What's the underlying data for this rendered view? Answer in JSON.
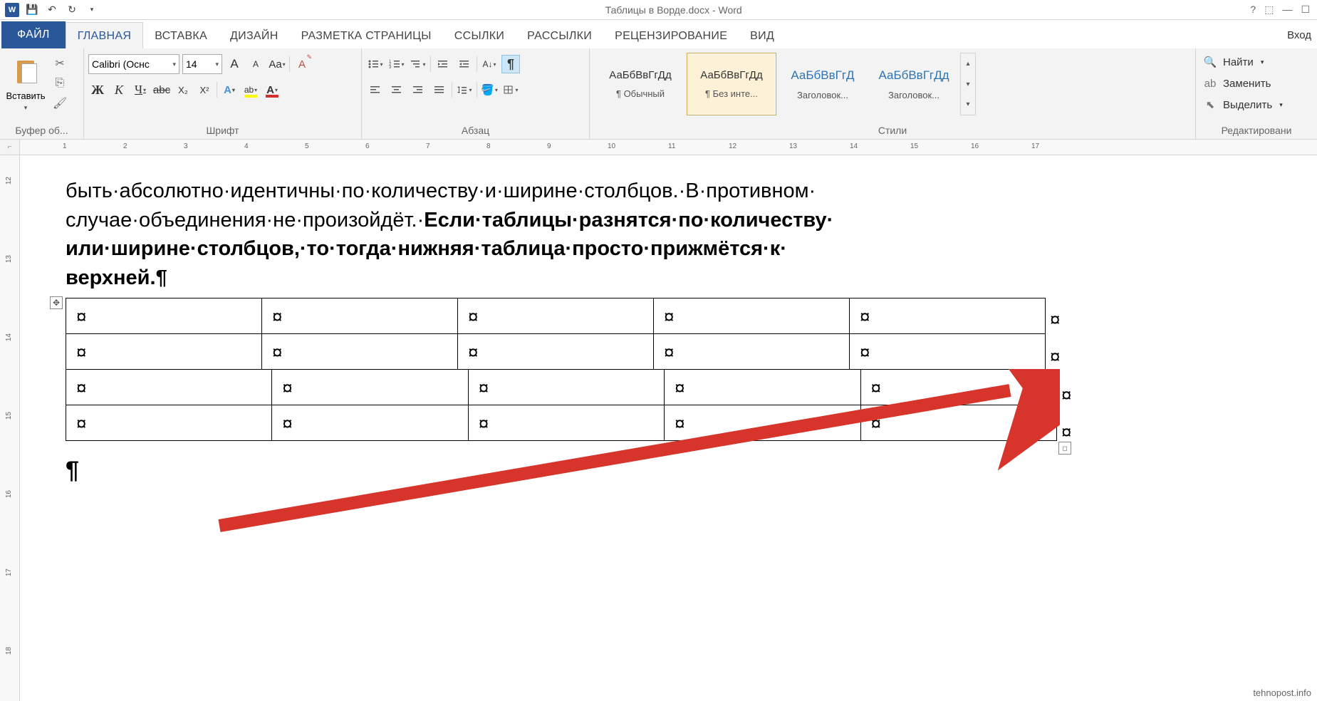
{
  "title": "Таблицы в Ворде.docx - Word",
  "login": "Вход",
  "tabs": {
    "file": "ФАЙЛ",
    "home": "ГЛАВНАЯ",
    "insert": "ВСТАВКА",
    "design": "ДИЗАЙН",
    "layout": "РАЗМЕТКА СТРАНИЦЫ",
    "references": "ССЫЛКИ",
    "mailings": "РАССЫЛКИ",
    "review": "РЕЦЕНЗИРОВАНИЕ",
    "view": "ВИД"
  },
  "clipboard": {
    "paste": "Вставить",
    "label": "Буфер об..."
  },
  "font": {
    "name": "Calibri (Оснс",
    "size": "14",
    "label": "Шрифт",
    "bold": "Ж",
    "italic": "К",
    "underline": "Ч",
    "strike": "abc",
    "sub": "X₂",
    "sup": "X²",
    "grow": "A",
    "shrink": "A",
    "case": "Aa",
    "clear": "A"
  },
  "para": {
    "label": "Абзац",
    "show_marks": "¶"
  },
  "styles": {
    "label": "Стили",
    "items": [
      {
        "preview": "АаБбВвГгДд",
        "name": "¶ Обычный",
        "heading": false
      },
      {
        "preview": "АаБбВвГгДд",
        "name": "¶ Без инте...",
        "heading": false
      },
      {
        "preview": "АаБбВвГгД",
        "name": "Заголовок...",
        "heading": true
      },
      {
        "preview": "АаБбВвГгДд",
        "name": "Заголовок...",
        "heading": true
      }
    ]
  },
  "editing": {
    "label": "Редактировани",
    "find": "Найти",
    "replace": "Заменить",
    "select": "Выделить"
  },
  "ruler_h": [
    "1",
    "2",
    "3",
    "4",
    "5",
    "6",
    "7",
    "8",
    "9",
    "10",
    "11",
    "12",
    "13",
    "14",
    "15",
    "16",
    "17"
  ],
  "ruler_v": [
    "12",
    "13",
    "14",
    "15",
    "16",
    "17",
    "18"
  ],
  "doc": {
    "line1": "быть·абсолютно·идентичны·по·количеству·и·ширине·столбцов.·В·противном·",
    "line2a": "случае·объединения·не·произойдёт.·",
    "line2b": "Если·таблицы·разнятся·по·количеству·",
    "line3": "или·ширине·столбцов,·то·тогда·нижняя·таблица·просто·прижмётся·к·",
    "line4": "верхней.",
    "pilcrow": "¶",
    "cell_mark": "¤"
  },
  "watermark": "tehnopost.info"
}
